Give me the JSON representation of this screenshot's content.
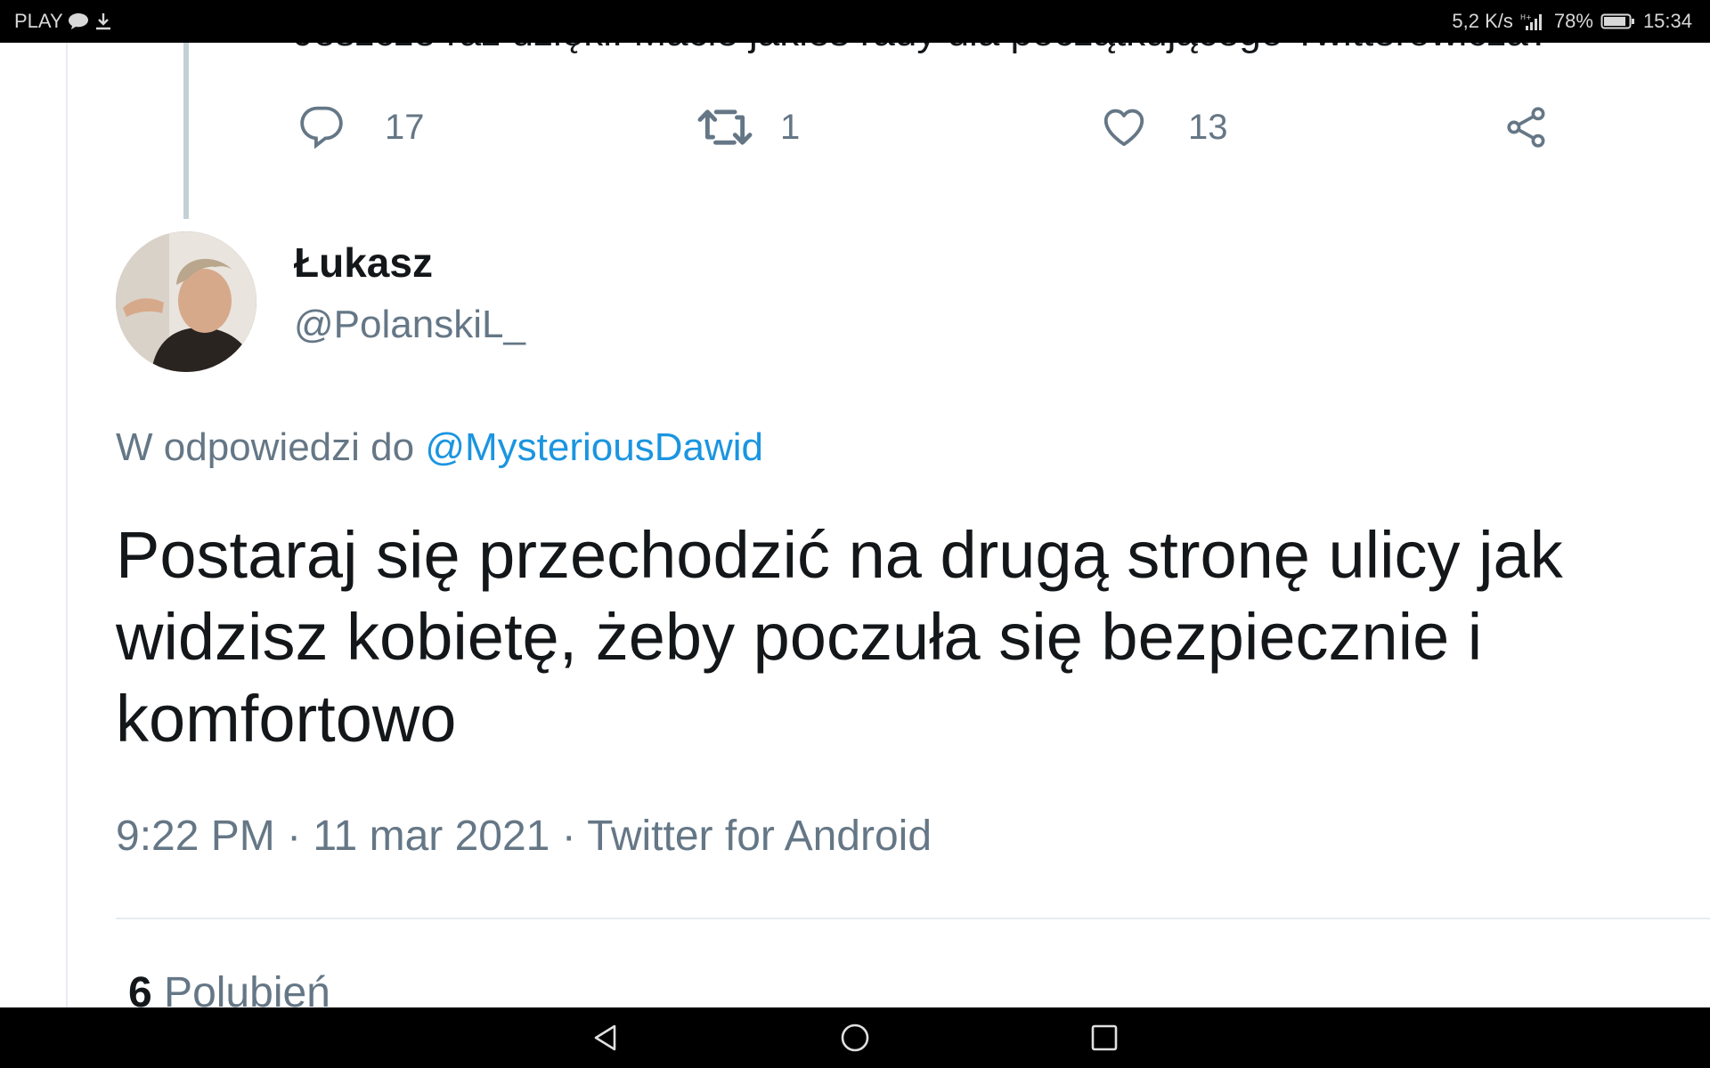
{
  "status_bar": {
    "carrier": "PLAY",
    "net_speed": "5,2 K/s",
    "battery": "78%",
    "time": "15:34",
    "icons": [
      "chat-bubble-icon",
      "download-icon",
      "signal-icon",
      "battery-icon"
    ]
  },
  "previous_tweet": {
    "text_partial": "Jeszcze raz dzięki. Macie jakieś rady dla początkującego Twitterowicza?",
    "reply_count": "17",
    "retweet_count": "1",
    "like_count": "13"
  },
  "tweet": {
    "display_name": "Łukasz",
    "handle": "@PolanskiL_",
    "reply_prefix": "W odpowiedzi do",
    "reply_mention": "@MysteriousDawid",
    "text": "Postaraj się przechodzić na drugą stronę ulicy jak widzisz kobietę, żeby poczuła się bezpiecznie i komfortowo",
    "time": "9:22 PM",
    "date": "11 mar 2021",
    "client": "Twitter for Android",
    "separator": " · ",
    "likes_count": "6",
    "likes_label": "Polubień"
  },
  "nav_bar": {
    "buttons": [
      "back-icon",
      "home-icon",
      "recents-icon"
    ]
  },
  "colors": {
    "text": "#14171a",
    "secondary": "#657786",
    "link": "#1b95e0",
    "divider": "#e6ecf0"
  }
}
